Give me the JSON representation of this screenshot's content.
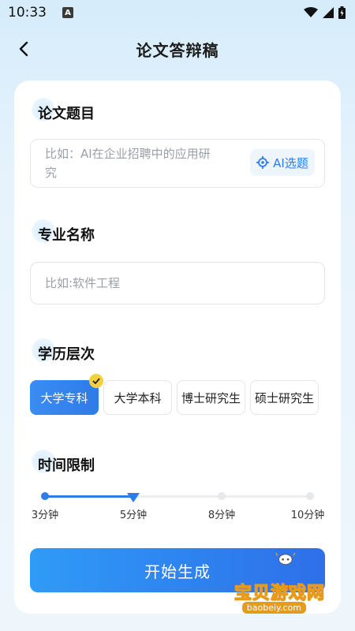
{
  "status_bar": {
    "time": "10:33",
    "notification_letter": "A"
  },
  "header": {
    "title": "论文答辩稿"
  },
  "thesis_topic": {
    "label": "论文题目",
    "placeholder_line1": "比如：AI在企业招聘中的应用研",
    "placeholder_line2": "究",
    "ai_button_label": "AI选题"
  },
  "major": {
    "label": "专业名称",
    "placeholder": "比如:软件工程"
  },
  "education": {
    "label": "学历层次",
    "options": [
      "大学专科",
      "大学本科",
      "博士研究生",
      "硕士研究生"
    ],
    "selected": "大学专科"
  },
  "time_limit": {
    "label": "时间限制",
    "stops": [
      "3分钟",
      "5分钟",
      "8分钟",
      "10分钟"
    ],
    "selected": "5分钟"
  },
  "start_button_label": "开始生成",
  "watermark": {
    "title": "宝贝游戏网",
    "url": "baobeiy.com"
  },
  "colors": {
    "accent": "#2f7be9",
    "check_badge": "#f3d13b",
    "watermark": "#e79a1b"
  }
}
